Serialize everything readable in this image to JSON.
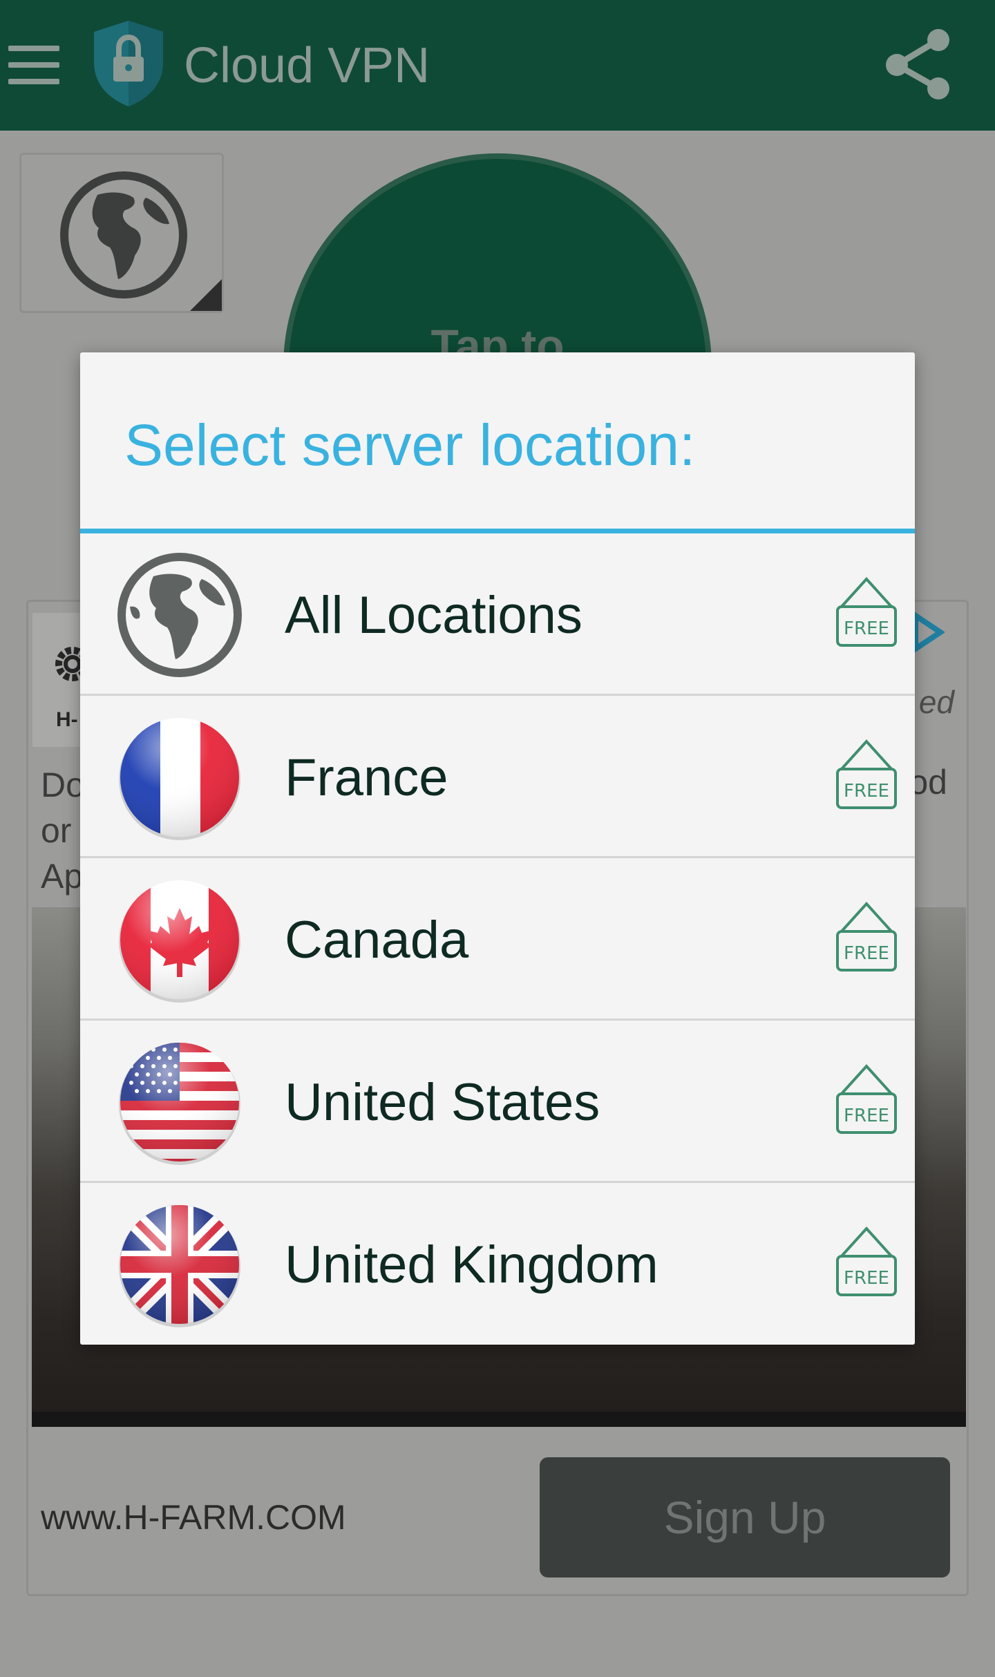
{
  "app_bar": {
    "title": "Cloud VPN",
    "menu_icon": "hamburger-menu-icon",
    "logo_icon": "shield-lock-icon",
    "share_icon": "share-icon",
    "color": "#0f4a37"
  },
  "background": {
    "connect_button_text": "Tap to",
    "ad": {
      "logo_text": "H-",
      "text_left": "Do\nor\nAp",
      "sponsored": "ed",
      "text_right": "od",
      "url": "www.H-FARM.COM",
      "cta": "Sign Up"
    }
  },
  "dialog": {
    "title": "Select server location:",
    "accent_color": "#3ab2df",
    "items": [
      {
        "label": "All Locations",
        "icon": "globe-icon",
        "badge": "FREE"
      },
      {
        "label": "France",
        "icon": "france-flag-icon",
        "badge": "FREE"
      },
      {
        "label": "Canada",
        "icon": "canada-flag-icon",
        "badge": "FREE"
      },
      {
        "label": "United States",
        "icon": "us-flag-icon",
        "badge": "FREE"
      },
      {
        "label": "United Kingdom",
        "icon": "uk-flag-icon",
        "badge": "FREE"
      }
    ]
  }
}
